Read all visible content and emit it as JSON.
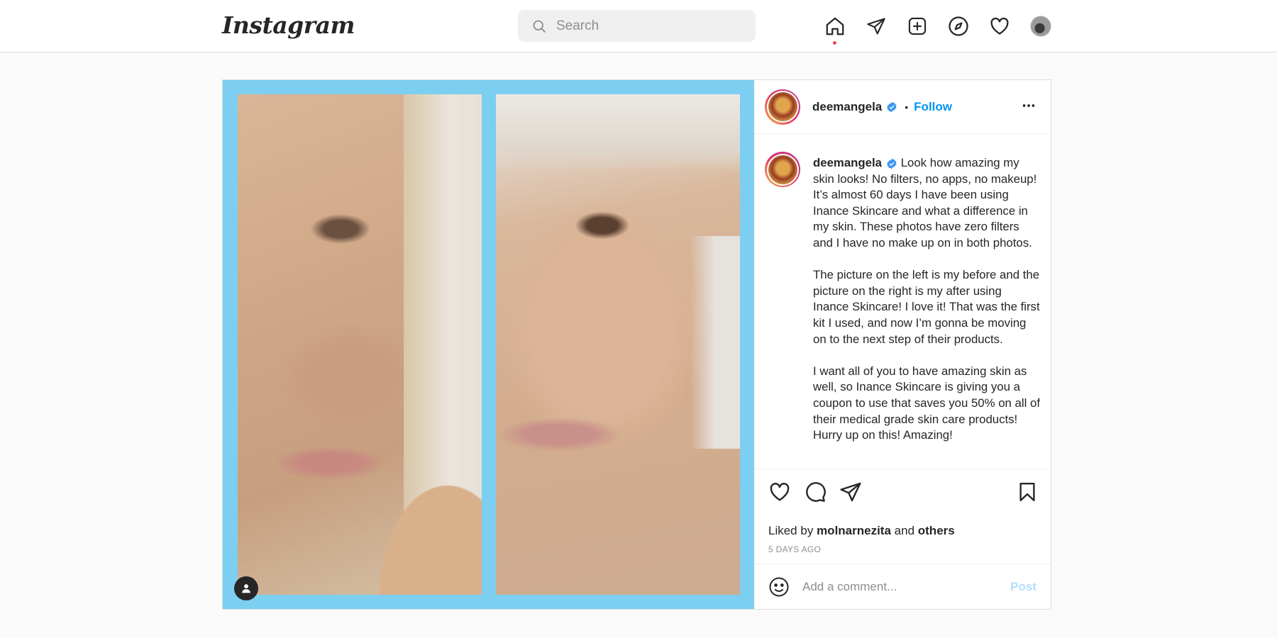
{
  "header": {
    "logo": "Instagram",
    "search_placeholder": "Search",
    "nav": [
      "home-icon",
      "direct-icon",
      "new-post-icon",
      "explore-icon",
      "activity-icon",
      "profile-avatar"
    ]
  },
  "post": {
    "author": {
      "username": "deemangela",
      "verified": true,
      "follow_label": "Follow",
      "separator": "•"
    },
    "caption": {
      "username": "deemangela",
      "paragraphs": [
        "Look how amazing my skin looks! No filters, no apps, no makeup! It’s almost 60 days I have been using Inance Skincare and what a difference in my skin. These photos have zero filters and I have no make up on in both photos.",
        "The picture on the left is my before and the picture on the right is my after using Inance Skincare! I love it! That was the first kit I used, and now I’m gonna be moving on to the next step of their products.",
        "I want all of you to have amazing skin as well, so Inance Skincare is giving you a coupon to use that saves you 50% on all of their medical grade skin care products! Hurry up on this! Amazing!"
      ]
    },
    "likes": {
      "prefix": "Liked by",
      "user": "molnarnezita",
      "conjunction": "and",
      "others": "others"
    },
    "date": "5 DAYS AGO",
    "comment": {
      "placeholder": "Add a comment...",
      "post_label": "Post"
    }
  },
  "colors": {
    "accent": "#0095f6",
    "media_border": "#7ccff0",
    "notification_dot": "#ed4956",
    "post_disabled": "#b2dffc"
  }
}
